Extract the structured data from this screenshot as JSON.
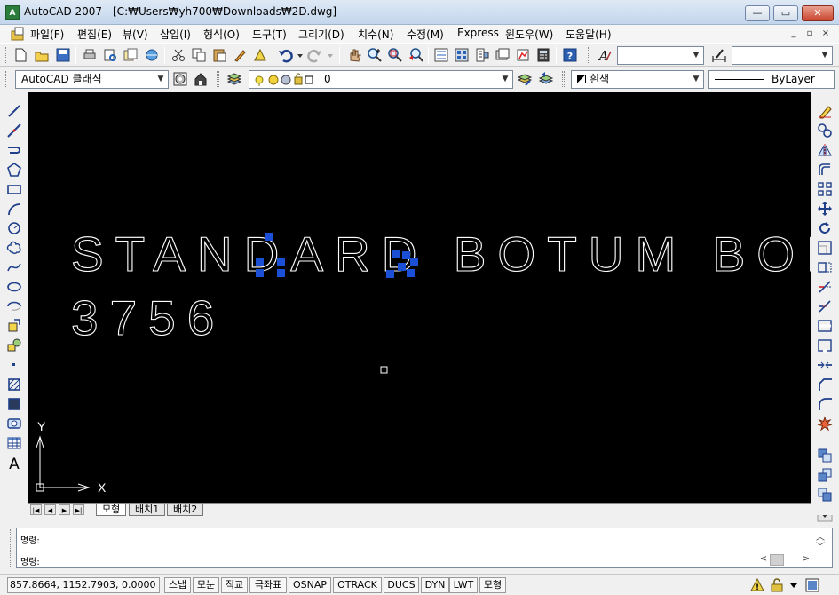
{
  "window": {
    "app_icon_text": "A",
    "title": "AutoCAD 2007 - [C:₩Users₩yh700₩Downloads₩2D.dwg]",
    "min_glyph": "—",
    "max_glyph": "▭",
    "close_glyph": "✕"
  },
  "menu": {
    "items": [
      "파일(F)",
      "편집(E)",
      "뷰(V)",
      "삽입(I)",
      "형식(O)",
      "도구(T)",
      "그리기(D)",
      "치수(N)",
      "수정(M)",
      "Express",
      "윈도우(W)",
      "도움말(H)"
    ],
    "mdi_min": "_",
    "mdi_restore": "▫",
    "mdi_close": "×"
  },
  "toolbar2": {
    "workspace": "AutoCAD 클래식",
    "layer": "0",
    "color": "흰색",
    "linetype": "ByLayer"
  },
  "drawing": {
    "line1": "STANDARD BOTUM BODY GU",
    "line2": "3756",
    "ucs_x": "X",
    "ucs_y": "Y"
  },
  "tabs": {
    "nav": [
      "|◀",
      "◀",
      "▶",
      "▶|"
    ],
    "items": [
      "모형",
      "배치1",
      "배치2"
    ]
  },
  "command": {
    "line1": "명령:",
    "line2": "명령:",
    "up": "︿",
    "down": "﹀",
    "left": "<",
    "right": ">"
  },
  "status": {
    "coords": "857.8664, 1152.7903, 0.0000",
    "buttons": [
      "스냅",
      "모눈",
      "직교",
      "극좌표",
      "OSNAP",
      "OTRACK",
      "DUCS",
      "DYN",
      "LWT",
      "모형"
    ]
  },
  "colors": {
    "canvas": "#000000",
    "drawing_text": "#ffffff",
    "grip": "#1a4fd6"
  }
}
